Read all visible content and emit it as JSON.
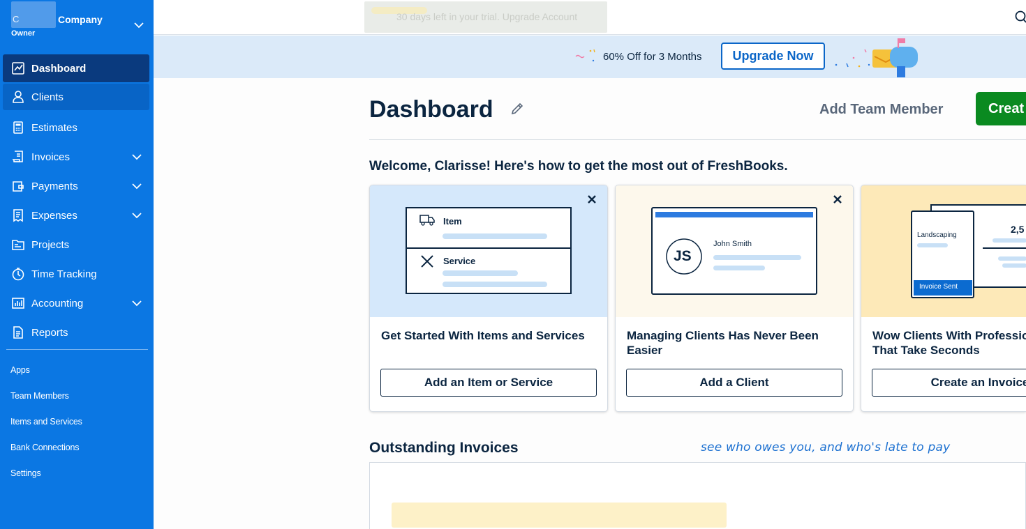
{
  "sidebar": {
    "company_blur_text": "C",
    "company_name": "Company",
    "role": "Owner",
    "items": [
      {
        "label": "Dashboard",
        "icon": "chart-line-icon"
      },
      {
        "label": "Clients",
        "icon": "user-icon"
      },
      {
        "label": "Estimates",
        "icon": "calculator-icon"
      },
      {
        "label": "Invoices",
        "icon": "invoice-icon"
      },
      {
        "label": "Payments",
        "icon": "wallet-icon"
      },
      {
        "label": "Expenses",
        "icon": "receipt-icon"
      },
      {
        "label": "Projects",
        "icon": "folder-icon"
      },
      {
        "label": "Time Tracking",
        "icon": "clock-icon"
      },
      {
        "label": "Accounting",
        "icon": "bar-chart-icon"
      },
      {
        "label": "Reports",
        "icon": "report-icon"
      }
    ],
    "links": [
      "Apps",
      "Team Members",
      "Items and Services",
      "Bank Connections",
      "Settings"
    ]
  },
  "topbar": {
    "trial_text": "30 days left in your trial. Upgrade Account"
  },
  "promo": {
    "text": "60% Off for 3 Months",
    "button": "Upgrade Now"
  },
  "main": {
    "title": "Dashboard",
    "add_team": "Add Team Member",
    "create": "Creat",
    "welcome": "Welcome, Clarisse! Here's how to get the most out of FreshBooks."
  },
  "cards": [
    {
      "title": "Get Started With Items and Services",
      "button": "Add an Item or Service",
      "art": {
        "item": "Item",
        "service": "Service"
      }
    },
    {
      "title": "Managing Clients Has Never Been Easier",
      "button": "Add a Client",
      "art": {
        "initials": "JS",
        "name": "John Smith"
      }
    },
    {
      "title": "Wow Clients With Professional Invoices That Take Seconds",
      "button": "Create an Invoice",
      "art": {
        "label": "Landscaping",
        "amount": "2,5",
        "badge": "Invoice Sent"
      }
    }
  ],
  "outstanding": {
    "title": "Outstanding Invoices",
    "note": "see who owes you, and who's late to pay"
  },
  "colors": {
    "sidebar_bg": "#0b77e3",
    "active_item": "#0a3a7e",
    "create_green": "#0a8a20",
    "promo_bg": "#dbeaf9",
    "card1_bg": "#d5e8fb",
    "card2_bg": "#fdf8ec",
    "card3_bg": "#fde9b8"
  }
}
